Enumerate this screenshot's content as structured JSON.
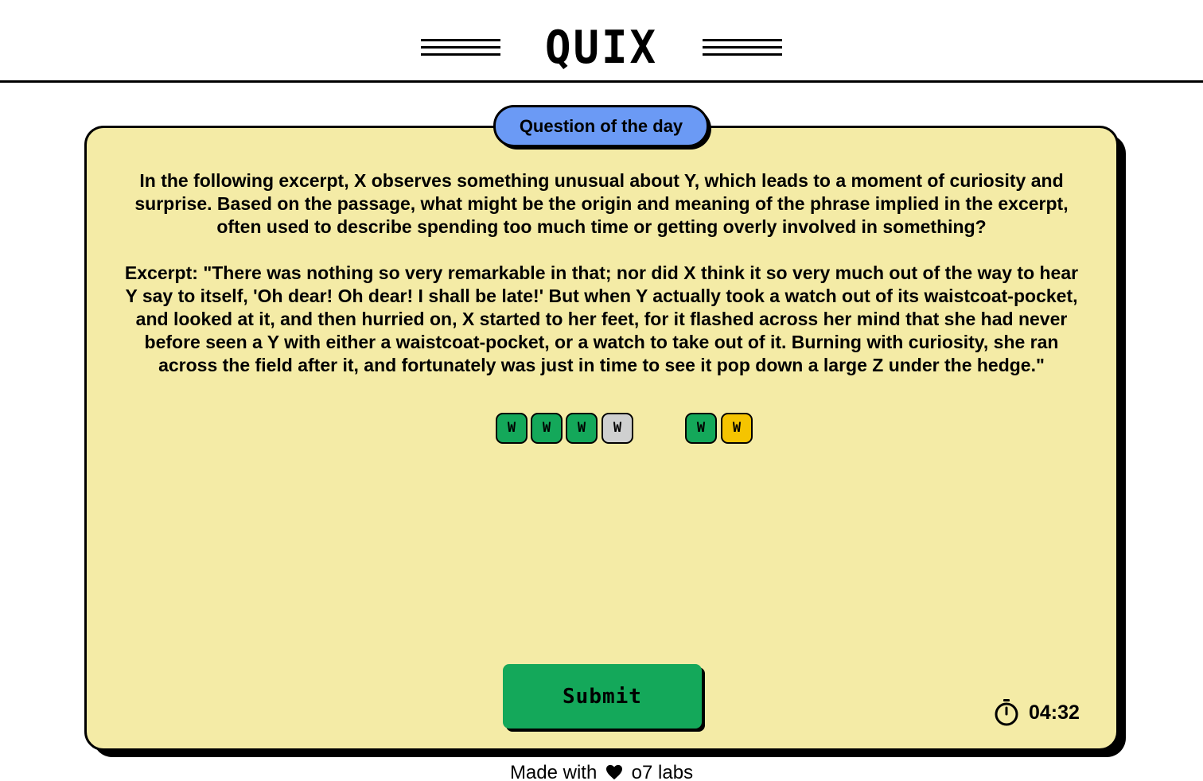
{
  "header": {
    "logo": "QUIX"
  },
  "card": {
    "badge": "Question of the day",
    "question": "In the following excerpt, X observes something unusual about Y, which leads to a moment of curiosity and surprise. Based on the passage, what might be the origin and meaning of the phrase implied in the excerpt, often used to describe spending too much time or getting overly involved in something?",
    "excerpt": "Excerpt: \"There was nothing so very remarkable in that; nor did X think it so very much out of the way to hear Y say to itself, 'Oh dear! Oh dear! I shall be late!' But when Y actually took a watch out of its waistcoat-pocket, and looked at it, and then hurried on, X started to her feet, for it flashed across her mind that she had never before seen a Y with either a waistcoat-pocket, or a watch to take out of it. Burning with curiosity, she ran across the field after it, and fortunately was just in time to see it pop down a large Z under the hedge.\"",
    "word_tiles": [
      {
        "tiles": [
          {
            "letter": "W",
            "state": "correct"
          },
          {
            "letter": "W",
            "state": "correct"
          },
          {
            "letter": "W",
            "state": "correct"
          },
          {
            "letter": "W",
            "state": "empty"
          }
        ]
      },
      {
        "tiles": [
          {
            "letter": "W",
            "state": "correct"
          },
          {
            "letter": "W",
            "state": "present"
          }
        ]
      }
    ],
    "submit_label": "Submit",
    "timer": "04:32"
  },
  "footer": {
    "prefix": "Made with",
    "icon": "heart-icon",
    "suffix": "o7 labs"
  },
  "colors": {
    "card_bg": "#f4eba6",
    "badge_bg": "#6b9af5",
    "correct": "#14a85a",
    "present": "#f5c400",
    "empty": "#cfd0d0",
    "submit_bg": "#14a85a"
  }
}
